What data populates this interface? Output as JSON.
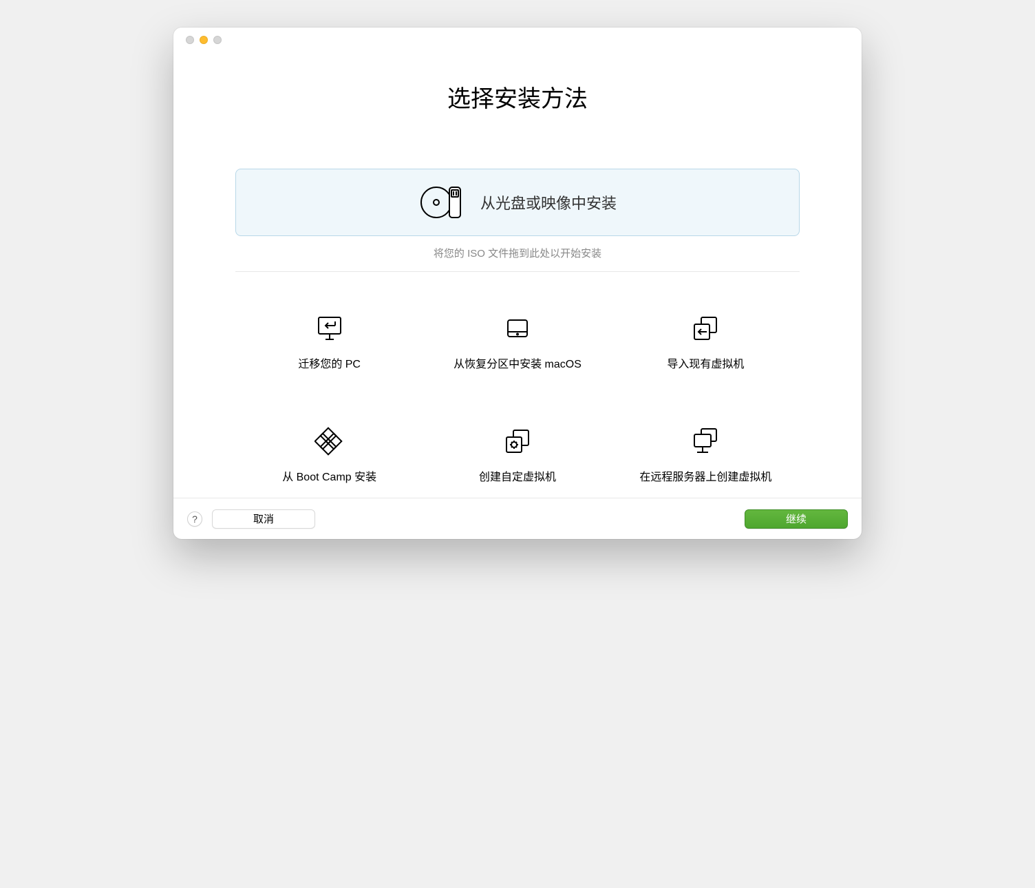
{
  "title": "选择安装方法",
  "primary": {
    "label": "从光盘或映像中安装",
    "hint": "将您的 ISO 文件拖到此处以开始安装"
  },
  "options": [
    {
      "label": "迁移您的 PC"
    },
    {
      "label": "从恢复分区中安装 macOS"
    },
    {
      "label": "导入现有虚拟机"
    },
    {
      "label": "从 Boot Camp 安装"
    },
    {
      "label": "创建自定虚拟机"
    },
    {
      "label": "在远程服务器上创建虚拟机"
    }
  ],
  "footer": {
    "help": "?",
    "cancel": "取消",
    "continue": "继续"
  }
}
